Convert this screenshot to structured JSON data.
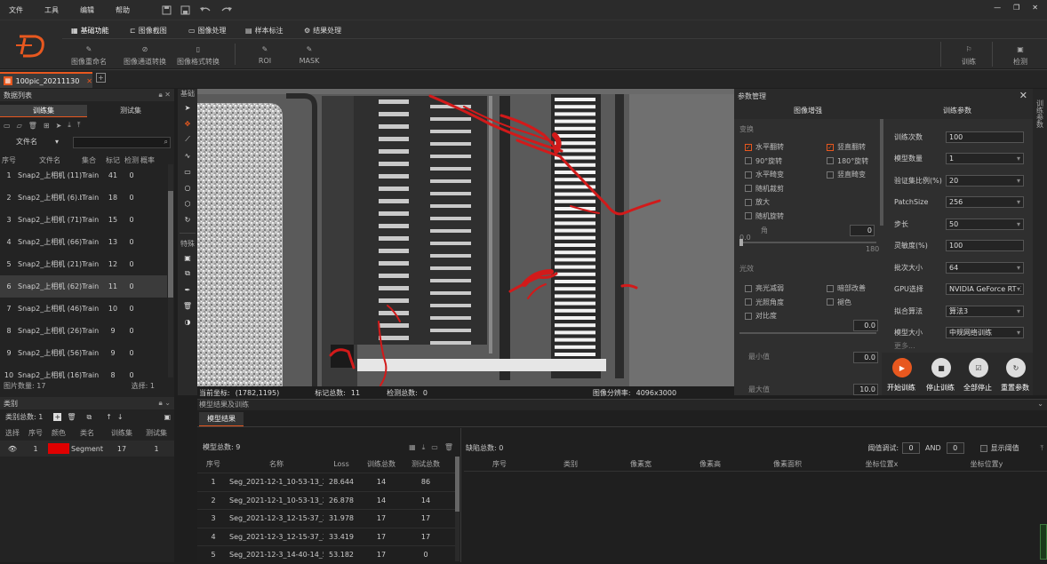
{
  "menu": [
    "文件",
    "工具",
    "编辑",
    "帮助"
  ],
  "ribbon_tabs": [
    "基础功能",
    "图像截图",
    "图像处理",
    "样本标注",
    "结果处理"
  ],
  "ribbon_buttons": [
    "图像重命名",
    "图像通道转换",
    "图像格式转换",
    "ROI",
    "MASK",
    "训练",
    "检测"
  ],
  "doc_tab": "100pic_20211130",
  "left": {
    "title": "数据列表",
    "set_tabs": [
      "训练集",
      "测试集"
    ],
    "filter_label": "文件名",
    "headers": [
      "序号",
      "文件名",
      "集合",
      "标记",
      "检测",
      "概率"
    ],
    "rows": [
      [
        "1",
        "Snap2_上相机 (11).bm",
        "Train",
        "41",
        "0"
      ],
      [
        "2",
        "Snap2_上相机 (6).bm",
        "Train",
        "18",
        "0"
      ],
      [
        "3",
        "Snap2_上相机 (71).bm",
        "Train",
        "15",
        "0"
      ],
      [
        "4",
        "Snap2_上相机 (66).b",
        "Train",
        "13",
        "0"
      ],
      [
        "5",
        "Snap2_上相机 (21).b",
        "Train",
        "12",
        "0"
      ],
      [
        "6",
        "Snap2_上相机 (62).b",
        "Train",
        "11",
        "0"
      ],
      [
        "7",
        "Snap2_上相机 (46).b",
        "Train",
        "10",
        "0"
      ],
      [
        "8",
        "Snap2_上相机 (26).b",
        "Train",
        "9",
        "0"
      ],
      [
        "9",
        "Snap2_上相机 (56).b",
        "Train",
        "9",
        "0"
      ],
      [
        "10",
        "Snap2_上相机 (16).b",
        "Train",
        "8",
        "0"
      ]
    ],
    "image_count_label": "图片数量: 17",
    "select_label": "选择: 1",
    "category_title": "类别",
    "category_count": "类别总数: 1",
    "cat_headers": [
      "选择",
      "序号",
      "颜色",
      "类名",
      "训练集",
      "测试集"
    ],
    "cat_row": [
      "1",
      "Segment 0",
      "17",
      "1"
    ],
    "cat_color": "#e00000"
  },
  "tools": {
    "basic": "基础",
    "special": "特殊"
  },
  "status": {
    "coord_label": "当前坐标:",
    "coord": "(1782,1195)",
    "mark_label": "标记总数:",
    "mark": "11",
    "detect_label": "检测总数:",
    "detect": "0",
    "res_label": "图像分辨率:",
    "res": "4096x3000"
  },
  "param": {
    "title": "参数管理",
    "aug_title": "图像增强",
    "train_title": "训练参数",
    "transform": "变换",
    "checks_left": [
      "水平翻转",
      "90°旋转",
      "水平畸变",
      "随机裁剪",
      "放大",
      "随机旋转"
    ],
    "checks_right": [
      "竖直翻转",
      "180°旋转",
      "竖直畸变"
    ],
    "angle_label": "角",
    "angle_value": "0",
    "scale_min": "0.0",
    "scale_max": "180",
    "light": "光效",
    "light_left": [
      "亮光减弱",
      "光照角度",
      "对比度"
    ],
    "light_right": [
      "暗部改善",
      "褪色"
    ],
    "field_a": "0.0",
    "field_b": "0.0",
    "field_c": "10.0",
    "min_label": "最小值",
    "max_label": "最大值",
    "train_labels": [
      "训练次数",
      "模型数量",
      "验证集比例(%)",
      "PatchSize",
      "步长",
      "灵敏度(%)",
      "批次大小",
      "GPU选择",
      "拟合算法",
      "模型大小"
    ],
    "train_values": [
      "100",
      "1",
      "20",
      "256",
      "50",
      "100",
      "64",
      "NVIDIA GeForce RTX",
      "算法3",
      "中规网络训练"
    ],
    "more": "更多...",
    "actions": [
      "开始训练",
      "停止训练",
      "全部停止",
      "重置参数"
    ]
  },
  "bottom": {
    "section_title": "模型结果及训练",
    "tab": "模型结果",
    "model_count": "模型总数: 9",
    "headers": [
      "序号",
      "名称",
      "Loss",
      "训练总数",
      "测试总数"
    ],
    "rows": [
      [
        "1",
        "Seg_2021-12-1_10-53-13_28.6",
        "28.644",
        "14",
        "86"
      ],
      [
        "2",
        "Seg_2021-12-1_10-53-13_26.8",
        "26.878",
        "14",
        "14"
      ],
      [
        "3",
        "Seg_2021-12-3_12-15-37_31.9",
        "31.978",
        "17",
        "17"
      ],
      [
        "4",
        "Seg_2021-12-3_12-15-37_33.4",
        "33.419",
        "17",
        "17"
      ],
      [
        "5",
        "Seg_2021-12-3_14-40-14_53.1",
        "53.182",
        "17",
        "0"
      ]
    ],
    "defect_count": "缺陷总数: 0",
    "threshold_label": "阈值调试:",
    "th_a": "0",
    "and": "AND",
    "th_b": "0",
    "show_threshold": "显示阈值",
    "defect_headers": [
      "序号",
      "类别",
      "像素宽",
      "像素高",
      "像素面积",
      "坐标位置x",
      "坐标位置y"
    ]
  },
  "side_label": "训练参数",
  "accent": "#e8581f"
}
